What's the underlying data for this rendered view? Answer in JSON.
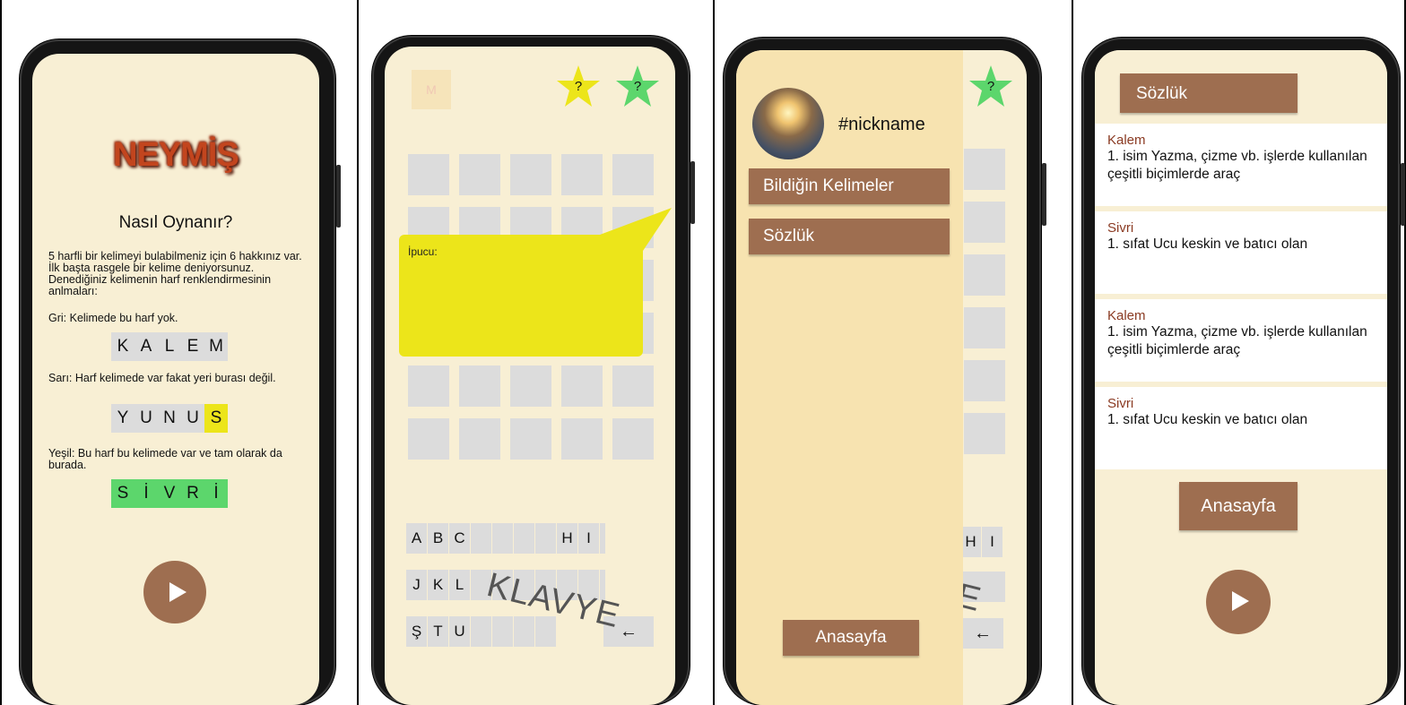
{
  "screen1": {
    "logo": "NEYMİŞ",
    "title": "Nasıl Oynanır?",
    "intro": "5 harfli bir kelimeyi bulabilmeniz için 6 hakkınız var. İlk başta rasgele bir kelime deniyorsunuz. Denediğiniz kelimenin harf renklendirmesinin anlmaları:",
    "gray_rule": "Gri: Kelimede bu harf yok.",
    "gray_example": [
      "K",
      "A",
      "L",
      "E",
      "M"
    ],
    "yellow_rule": "Sarı: Harf kelimede var fakat yeri burası değil.",
    "yellow_example": [
      "Y",
      "U",
      "N",
      "U",
      "S"
    ],
    "green_rule": "Yeşil: Bu harf bu kelimede var ve tam olarak da burada.",
    "green_example": [
      "S",
      "İ",
      "V",
      "R",
      "İ"
    ],
    "colors": {
      "gray": "#dcdcdc",
      "yellow": "#ece51a",
      "green": "#5cd66c"
    }
  },
  "screen2": {
    "menu_letter": "M",
    "star_yellow_label": "?",
    "star_green_label": "?",
    "hint_label": "İpucu:",
    "keyboard_row1": [
      "A",
      "B",
      "C",
      "",
      "",
      "",
      "",
      "H",
      "I"
    ],
    "keyboard_row2": [
      "J",
      "K",
      "L",
      "",
      "",
      "",
      "",
      "",
      ""
    ],
    "keyboard_row3": [
      "Ş",
      "T",
      "U",
      "",
      "",
      "",
      ""
    ],
    "backspace": "←",
    "keyboard_watermark": "KLAVYE"
  },
  "screen3": {
    "nickname": "#nickname",
    "menu_known_words": "Bildiğin Kelimeler",
    "menu_dictionary": "Sözlük",
    "home_button": "Anasayfa",
    "star_label": "?",
    "peek_keys": [
      "H",
      "I"
    ],
    "peek_watermark": "E",
    "peek_backspace": "←"
  },
  "screen4": {
    "title": "Sözlük",
    "entries": [
      {
        "word": "Kalem",
        "def": "1. isim Yazma, çizme vb. işlerde kullanılan çeşitli biçimlerde araç"
      },
      {
        "word": "Sivri",
        "def": "1. sıfat Ucu keskin ve batıcı olan"
      },
      {
        "word": "Kalem",
        "def": "1. isim Yazma, çizme vb. işlerde kullanılan çeşitli biçimlerde araç"
      },
      {
        "word": "Sivri",
        "def": "1. sıfat Ucu keskin ve batıcı olan"
      }
    ],
    "home_button": "Anasayfa"
  }
}
